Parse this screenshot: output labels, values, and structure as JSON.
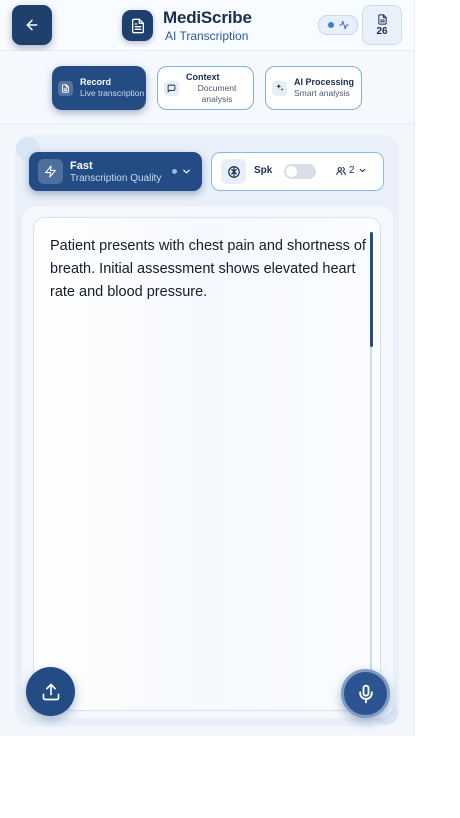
{
  "header": {
    "title": "MediScribe",
    "subtitle": "AI Transcription",
    "doc_count": "26"
  },
  "tabs": [
    {
      "label": "Record",
      "sub": "Live transcription",
      "active": true
    },
    {
      "label": "Context",
      "sub": "Document analysis",
      "active": false
    },
    {
      "label": "AI Processing",
      "sub": "Smart analysis",
      "active": false
    }
  ],
  "quality": {
    "label": "Fast",
    "sub": "Transcription Quality"
  },
  "speakers": {
    "label": "Spk",
    "toggle_on": false,
    "count": "2"
  },
  "transcript": {
    "text": "Patient presents with chest pain and shortness of breath. Initial assessment shows elevated heart rate and blood pressure."
  },
  "colors": {
    "primary": "#244c84",
    "accent_border": "#7fb0e0",
    "background": "#f3f7fc"
  },
  "icons": {
    "back": "arrow-left-icon",
    "logo": "document-icon",
    "status": "activity-icon",
    "doc_count": "document-icon",
    "record": "document-icon",
    "context": "message-square-icon",
    "ai": "sparkles-icon",
    "quality": "zap-icon",
    "speaker": "brain-icon",
    "speaker_count": "users-icon",
    "upload": "upload-icon",
    "mic": "microphone-icon"
  }
}
